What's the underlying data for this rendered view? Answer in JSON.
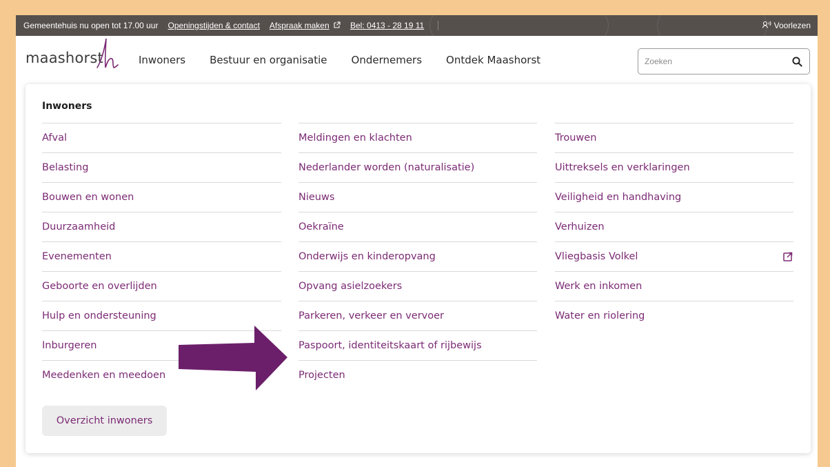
{
  "topbar": {
    "status": "Gemeentehuis nu open tot 17.00 uur",
    "links": [
      "Openingstijden & contact",
      "Afspraak maken",
      "Bel: 0413 - 28 19 11"
    ],
    "voorlezen": "Voorlezen"
  },
  "nav": {
    "logo": "maashorst",
    "menu": [
      "Inwoners",
      "Bestuur en organisatie",
      "Ondernemers",
      "Ontdek Maashorst"
    ],
    "search_placeholder": "Zoeken"
  },
  "panel": {
    "title": "Inwoners",
    "col1": [
      "Afval",
      "Belasting",
      "Bouwen en wonen",
      "Duurzaamheid",
      "Evenementen",
      "Geboorte en overlijden",
      "Hulp en ondersteuning",
      "Inburgeren",
      "Meedenken en meedoen"
    ],
    "col2": [
      "Meldingen en klachten",
      "Nederlander worden (naturalisatie)",
      "Nieuws",
      "Oekraïne",
      "Onderwijs en kinderopvang",
      "Opvang asielzoekers",
      "Parkeren, verkeer en vervoer",
      "Paspoort, identiteitskaart of rijbewijs",
      "Projecten"
    ],
    "col3": [
      "Trouwen",
      "Uittreksels en verklaringen",
      "Veiligheid en handhaving",
      "Verhuizen",
      "Vliegbasis Volkel",
      "Werk en inkomen",
      "Water en riolering"
    ],
    "overview_button": "Overzicht inwoners"
  },
  "colors": {
    "accent": "#7b2a74",
    "topbar": "#56504d",
    "background": "#f5c98f",
    "arrow": "#6b1f6a"
  },
  "icons": {
    "external": "external-link-icon",
    "search": "search-icon",
    "speaker": "speaker-icon"
  }
}
